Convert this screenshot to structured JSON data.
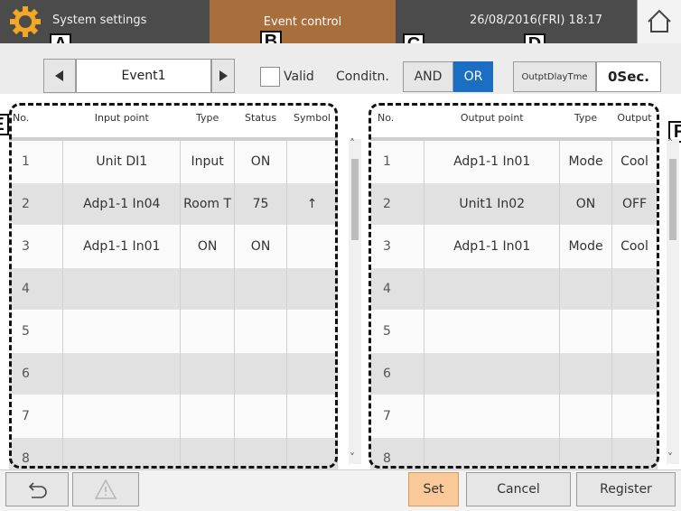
{
  "header": {
    "app_title": "System settings",
    "screen_title": "Event control",
    "datetime": "26/08/2016(FRI) 18:17"
  },
  "markers": {
    "a": "A",
    "b": "B",
    "c": "C",
    "d": "D",
    "e": "E",
    "f": "F"
  },
  "event": {
    "name": "Event1",
    "valid_label": "Valid",
    "valid_checked": false,
    "condition_label": "Conditn.",
    "and_label": "AND",
    "or_label": "OR",
    "selected_condition": "OR",
    "delay_label": "OutptDlayTme",
    "delay_value": "0Sec."
  },
  "input_table": {
    "headers": {
      "no": "No.",
      "point": "Input point",
      "type": "Type",
      "status": "Status",
      "symbol": "Symbol"
    },
    "rows": [
      {
        "no": "1",
        "point": "Unit DI1",
        "type": "Input",
        "status": "ON",
        "symbol": ""
      },
      {
        "no": "2",
        "point": "Adp1-1 In04",
        "type": "Room T",
        "status": "75",
        "symbol": "↑"
      },
      {
        "no": "3",
        "point": "Adp1-1 In01",
        "type": "ON",
        "status": "ON",
        "symbol": ""
      },
      {
        "no": "4",
        "point": "",
        "type": "",
        "status": "",
        "symbol": ""
      },
      {
        "no": "5",
        "point": "",
        "type": "",
        "status": "",
        "symbol": ""
      },
      {
        "no": "6",
        "point": "",
        "type": "",
        "status": "",
        "symbol": ""
      },
      {
        "no": "7",
        "point": "",
        "type": "",
        "status": "",
        "symbol": ""
      },
      {
        "no": "8",
        "point": "",
        "type": "",
        "status": "",
        "symbol": ""
      }
    ]
  },
  "output_table": {
    "headers": {
      "no": "No.",
      "point": "Output point",
      "type": "Type",
      "output": "Output"
    },
    "rows": [
      {
        "no": "1",
        "point": "Adp1-1 In01",
        "type": "Mode",
        "output": "Cool"
      },
      {
        "no": "2",
        "point": "Unit1 In02",
        "type": "ON",
        "output": "OFF"
      },
      {
        "no": "3",
        "point": "Adp1-1 In01",
        "type": "Mode",
        "output": "Cool"
      },
      {
        "no": "4",
        "point": "",
        "type": "",
        "output": ""
      },
      {
        "no": "5",
        "point": "",
        "type": "",
        "output": ""
      },
      {
        "no": "6",
        "point": "",
        "type": "",
        "output": ""
      },
      {
        "no": "7",
        "point": "",
        "type": "",
        "output": ""
      },
      {
        "no": "8",
        "point": "",
        "type": "",
        "output": ""
      }
    ]
  },
  "footer": {
    "set_label": "Set",
    "cancel_label": "Cancel",
    "register_label": "Register"
  },
  "colors": {
    "title_bar": "#4b4b4b",
    "tab_active": "#a86e3c",
    "or_selected": "#1b6ec2",
    "set_button": "#f9c99a"
  },
  "icons": {
    "app": "gear-icon",
    "home": "home-icon",
    "event_prev": "triangle-left-icon",
    "event_next": "triangle-right-icon",
    "back": "return-arrow-icon",
    "warning": "warning-triangle-icon"
  }
}
